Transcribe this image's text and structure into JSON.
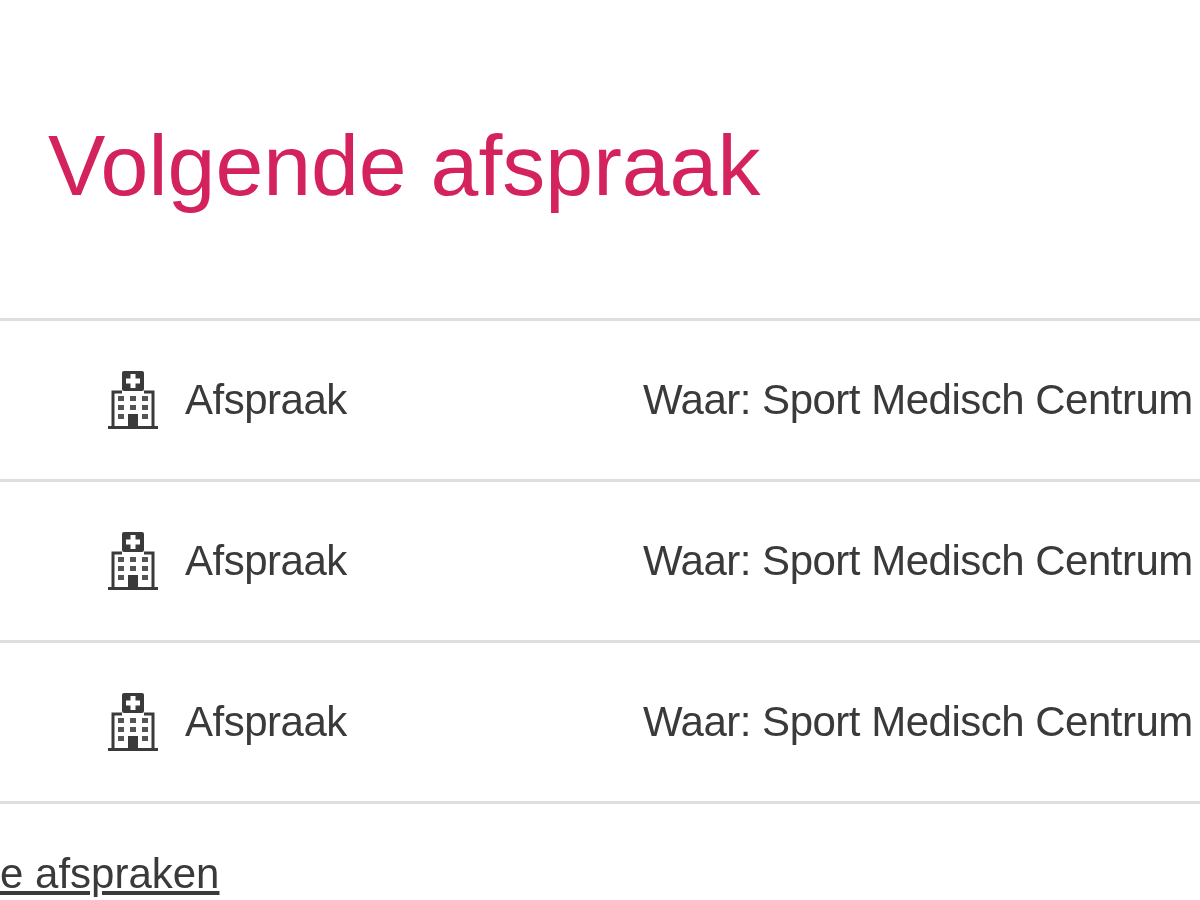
{
  "section": {
    "title": "Volgende afspraak"
  },
  "appointments": [
    {
      "type": "Afspraak",
      "location": "Waar: Sport Medisch Centrum"
    },
    {
      "type": "Afspraak",
      "location": "Waar: Sport Medisch Centrum"
    },
    {
      "type": "Afspraak",
      "location": "Waar: Sport Medisch Centrum"
    }
  ],
  "link": {
    "label": "e afspraken"
  }
}
